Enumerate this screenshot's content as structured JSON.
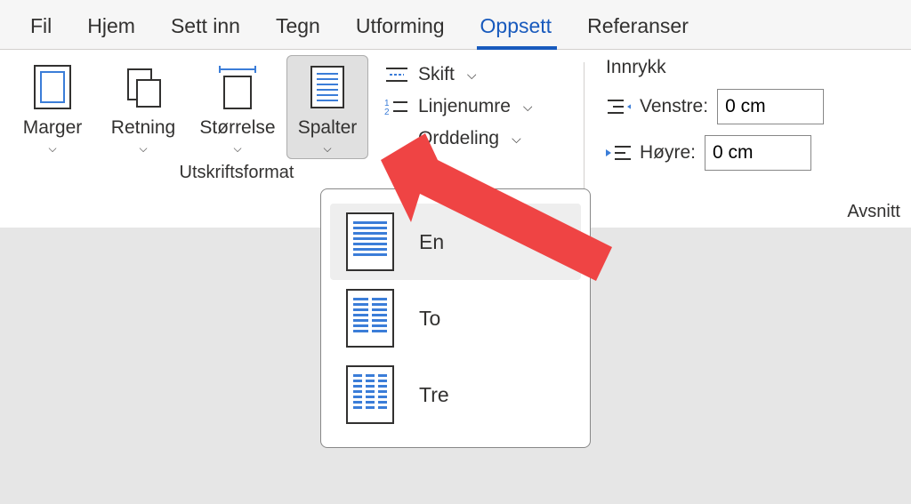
{
  "tabs": {
    "fil": "Fil",
    "hjem": "Hjem",
    "settinn": "Sett inn",
    "tegn": "Tegn",
    "utforming": "Utforming",
    "oppsett": "Oppsett",
    "referanser": "Referanser"
  },
  "active_tab": "Oppsett",
  "pagesetup": {
    "marger": "Marger",
    "retning": "Retning",
    "storrelse": "Størrelse",
    "spalter": "Spalter",
    "skift": "Skift",
    "linjenumre": "Linjenumre",
    "orddeling": "Orddeling",
    "group_label": "Utskriftsformat"
  },
  "indent": {
    "title": "Innrykk",
    "venstre": "Venstre:",
    "hoyre": "Høyre:",
    "value_left": "0 cm",
    "value_right": "0 cm",
    "group_label": "Avsnitt"
  },
  "columns_menu": {
    "en": "En",
    "to": "To",
    "tre": "Tre"
  },
  "chev": "⌵",
  "launcher": "↘"
}
